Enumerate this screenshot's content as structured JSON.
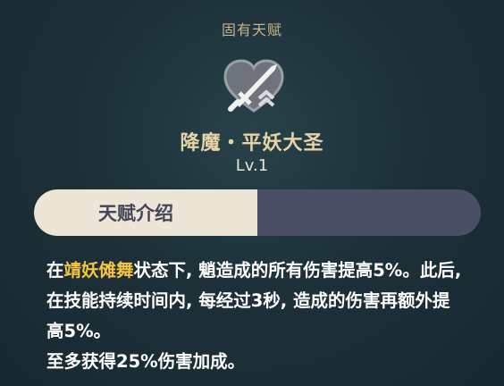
{
  "header": {
    "label": "固有天赋"
  },
  "talent": {
    "name": "降魔・平妖大圣",
    "level": "Lv.1"
  },
  "tabs": [
    {
      "label": "天赋介绍",
      "active": true
    },
    {
      "label": "",
      "active": false
    }
  ],
  "description": {
    "line1_prefix": "在",
    "line1_highlight": "靖妖傩舞",
    "line1_suffix": "状态下, 魈造成的所有伤害提高5%。此后, 在技能持续时间内, 每经过3秒, 造成的伤害再额外提高5%。",
    "line2": "至多获得25%伤害加成。"
  },
  "icons": {
    "talent": "sword-heart-icon"
  },
  "colors": {
    "header_text": "#c9b58a",
    "name_text": "#e7d3a5",
    "highlight": "#f5c542",
    "tab_active_bg": "#ede5d6",
    "tab_inactive_bg": "#4b4f66"
  }
}
